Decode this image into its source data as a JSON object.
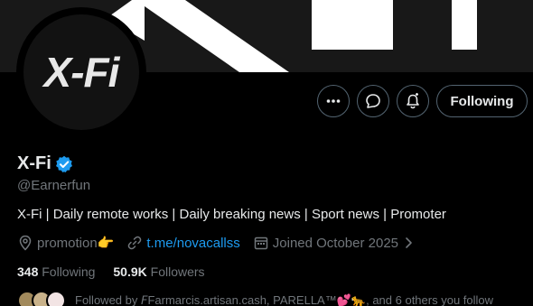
{
  "profile": {
    "name": "X-Fi",
    "handle": "@Earnerfun",
    "bio": "X-Fi | Daily remote works | Daily breaking news | Sport news | Promoter",
    "avatar_text": "X-Fi",
    "location": "promotion👉",
    "link": "t.me/novacallss",
    "joined": "Joined October 2025"
  },
  "stats": {
    "following_count": "348",
    "following_label": "Following",
    "followers_count": "50.9K",
    "followers_label": "Followers"
  },
  "followed_by": "Followed by 𝘍Farmarcis.artisan.cash, PARELLA™💕🐆, and 6 others you follow",
  "actions": {
    "following_button": "Following"
  },
  "colors": {
    "accent": "#1d9bf0",
    "background": "#000000",
    "muted": "#71767b"
  },
  "icons": [
    "more-icon",
    "message-icon",
    "notify-icon",
    "verified-icon",
    "location-icon",
    "link-icon",
    "calendar-icon",
    "chevron-right-icon"
  ]
}
